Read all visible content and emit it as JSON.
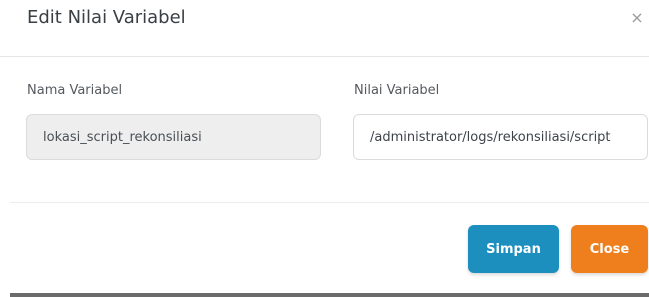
{
  "modal": {
    "title": "Edit Nilai Variabel",
    "close_icon": "close-icon",
    "close_glyph": "×"
  },
  "form": {
    "nama_label": "Nama Variabel",
    "nama_value": "lokasi_script_rekonsiliasi",
    "nilai_label": "Nilai Variabel",
    "nilai_value": "/administrator/logs/rekonsiliasi/script"
  },
  "footer": {
    "simpan_label": "Simpan",
    "close_label": "Close"
  },
  "colors": {
    "simpan_button": "#1c8fbf",
    "close_button": "#ee7f1c",
    "readonly_input_bg": "#eeeeee"
  }
}
